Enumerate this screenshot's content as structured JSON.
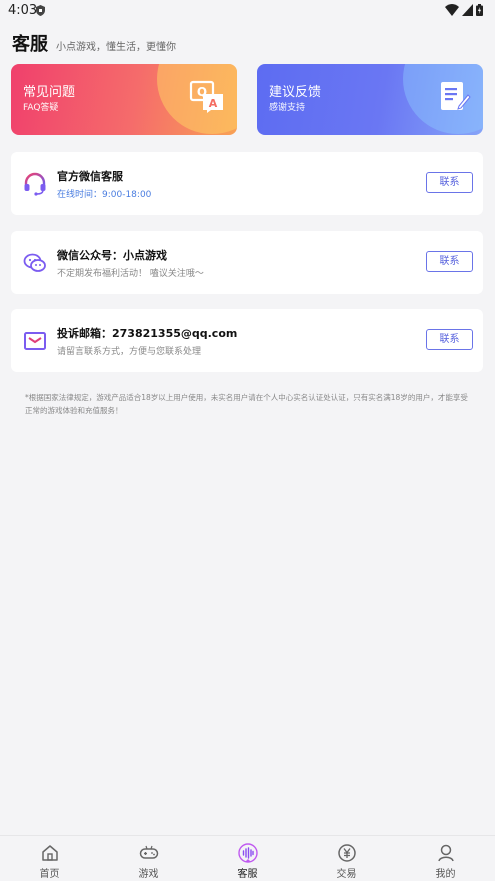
{
  "status_bar": {
    "time": "4:03"
  },
  "header": {
    "title": "客服",
    "subtitle": "小点游戏，懂生活，更懂你"
  },
  "cards": [
    {
      "title": "常见问题",
      "subtitle": "FAQ答疑",
      "icon": "faq-qa-icon"
    },
    {
      "title": "建议反馈",
      "subtitle": "感谢支持",
      "icon": "document-edit-icon"
    }
  ],
  "contacts": [
    {
      "title": "官方微信客服",
      "desc": "在线时间：9:00-18:00",
      "button": "联系",
      "icon": "headset-icon"
    },
    {
      "title": "微信公众号：小点游戏",
      "desc": "不定期发布福利活动！ 嗑议关注哦～",
      "button": "联系",
      "icon": "wechat-icon"
    },
    {
      "title": "投诉邮箱：273821355@qq.com",
      "desc": "请留言联系方式，方便与您联系处理",
      "button": "联系",
      "icon": "mail-icon"
    }
  ],
  "notice": "*根据国家法律规定，游戏产品适合18岁以上用户使用，未实名用户请在个人中心实名认证处认证，只有实名满18岁的用户，才能享受正常的游戏体验和充值服务！",
  "tabs": [
    {
      "label": "首页",
      "icon": "home-icon",
      "active": false
    },
    {
      "label": "游戏",
      "icon": "gamepad-icon",
      "active": false
    },
    {
      "label": "客服",
      "icon": "voice-service-icon",
      "active": true
    },
    {
      "label": "交易",
      "icon": "yuan-coin-icon",
      "active": false
    },
    {
      "label": "我的",
      "icon": "profile-icon",
      "active": false
    }
  ],
  "colors": {
    "faq_gradient": [
      "#f0406c",
      "#f8a155"
    ],
    "feedback_gradient": [
      "#5d6cf2",
      "#86a4f8"
    ],
    "accent": "#5560dd",
    "online_time": "#4a7de0"
  }
}
